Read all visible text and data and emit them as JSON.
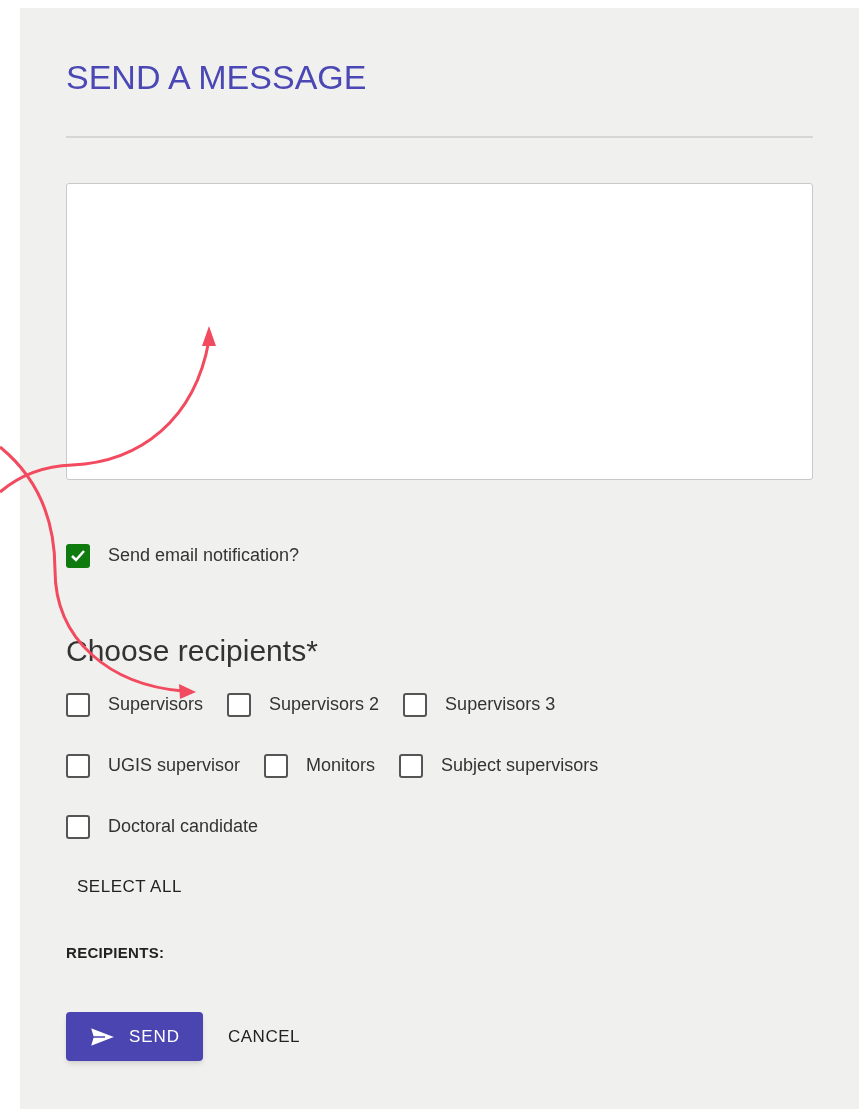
{
  "title": "SEND A MESSAGE",
  "notification": {
    "label": "Send email notification?",
    "checked": true
  },
  "recipients": {
    "heading": "Choose recipients*",
    "option_rows": [
      [
        {
          "label": "Supervisors",
          "checked": false
        },
        {
          "label": "Supervisors 2",
          "checked": false
        },
        {
          "label": "Supervisors 3",
          "checked": false
        }
      ],
      [
        {
          "label": "UGIS supervisor",
          "checked": false
        },
        {
          "label": "Monitors",
          "checked": false
        },
        {
          "label": "Subject supervisors",
          "checked": false
        }
      ],
      [
        {
          "label": "Doctoral candidate",
          "checked": false
        }
      ]
    ],
    "select_all": "SELECT ALL",
    "list_label": "RECIPIENTS:"
  },
  "buttons": {
    "send": "SEND",
    "cancel": "CANCEL"
  }
}
